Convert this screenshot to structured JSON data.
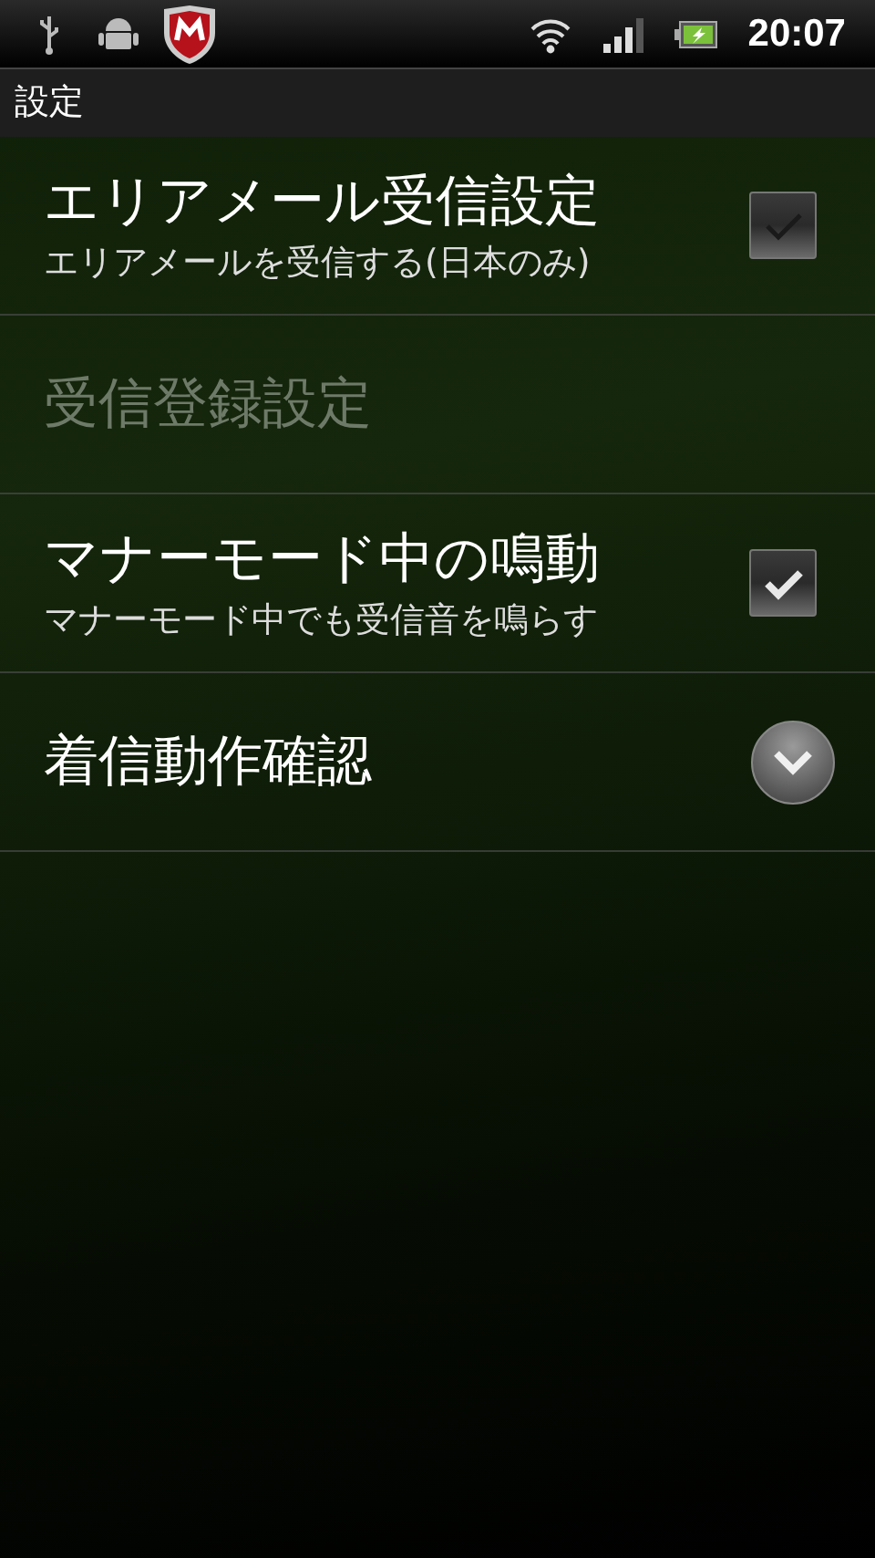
{
  "status_bar": {
    "time": "20:07"
  },
  "title_bar": {
    "title": "設定"
  },
  "settings": [
    {
      "kind": "checkbox",
      "title": "エリアメール受信設定",
      "summary": "エリアメールを受信する(日本のみ)",
      "checked": false,
      "disabled": false
    },
    {
      "kind": "plain",
      "title": "受信登録設定",
      "disabled": true
    },
    {
      "kind": "checkbox",
      "title": "マナーモード中の鳴動",
      "summary": "マナーモード中でも受信音を鳴らす",
      "checked": true,
      "disabled": false
    },
    {
      "kind": "dropdown",
      "title": "着信動作確認",
      "disabled": false
    }
  ]
}
